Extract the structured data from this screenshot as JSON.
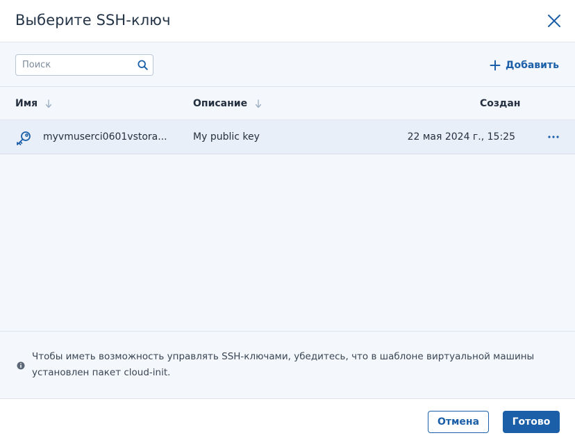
{
  "dialog": {
    "title": "Выберите SSH-ключ",
    "close_icon": "close-icon"
  },
  "toolbar": {
    "search_placeholder": "Поиск",
    "search_value": "",
    "add_label": "Добавить"
  },
  "table": {
    "columns": [
      {
        "label": "Имя",
        "sortable": true
      },
      {
        "label": "Описание",
        "sortable": true
      },
      {
        "label": "Создан",
        "sortable": false
      }
    ],
    "rows": [
      {
        "icon": "key-icon",
        "name": "myvmuserci0601vstora...",
        "description": "My public key",
        "created": "22 мая 2024 г., 15:25",
        "selected": true
      }
    ]
  },
  "info": {
    "icon": "info-icon",
    "text": "Чтобы иметь возможность управлять SSH-ключами, убедитесь, что в шаблоне виртуальной машины установлен пакет cloud-init."
  },
  "footer": {
    "cancel_label": "Отмена",
    "done_label": "Готово"
  },
  "colors": {
    "accent": "#1b5fa8",
    "panel_bg": "#f4f7fb",
    "selected_row_bg": "#e8eff8"
  }
}
